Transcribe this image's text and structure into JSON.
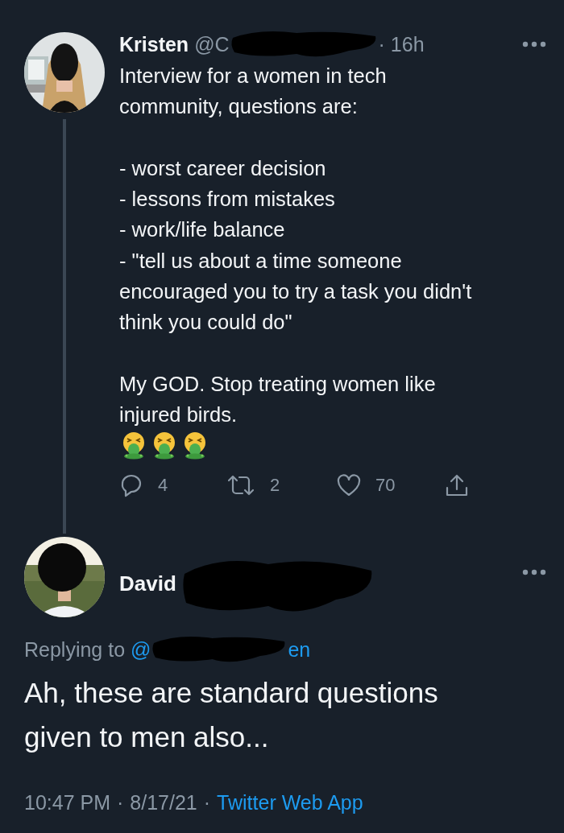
{
  "tweet": {
    "name": "Kristen",
    "handle_visible": "@C",
    "separator": "·",
    "time": "16h",
    "paragraphs": [
      [
        "Interview for a women in tech",
        "community, questions are:"
      ],
      [
        "- worst career decision",
        "- lessons from mistakes",
        "- work/life balance",
        "- \"tell us about a time someone",
        "encouraged you to try a task you didn't",
        "think you could do\""
      ],
      [
        "My GOD. Stop treating women like",
        "injured birds."
      ]
    ],
    "emojis": [
      {
        "kind": "vomiting-face"
      },
      {
        "kind": "vomiting-face"
      },
      {
        "kind": "vomiting-face"
      }
    ],
    "actions": [
      {
        "kind": "reply",
        "count": "4"
      },
      {
        "kind": "retweet",
        "count": "2"
      },
      {
        "kind": "like",
        "count": "70"
      },
      {
        "kind": "share"
      }
    ]
  },
  "reply": {
    "name": "David",
    "replying_label": "Replying to",
    "replying_start": "@",
    "replying_end": "en",
    "lines": [
      "Ah, these are standard questions",
      "given to men also..."
    ],
    "time": "10:47 PM",
    "separator_1": "·",
    "date": "8/17/21",
    "separator_2": "·",
    "source": "Twitter Web App"
  }
}
